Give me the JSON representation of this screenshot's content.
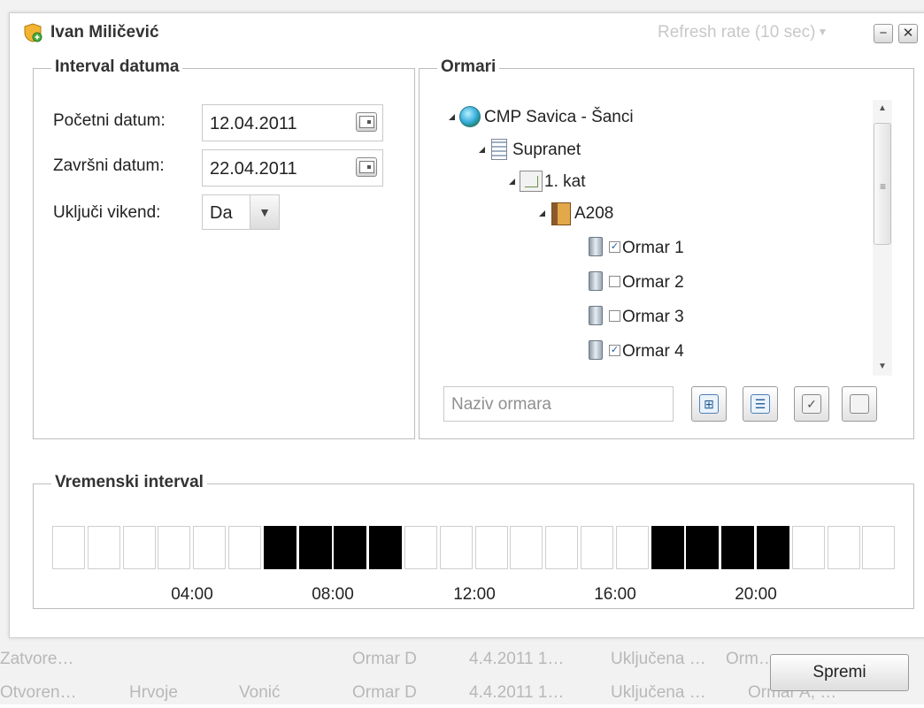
{
  "window": {
    "title": "Ivan Miličević",
    "refresh_rate": "Refresh rate (10 sec)",
    "minimize_glyph": "−",
    "close_glyph": "✕"
  },
  "date_interval": {
    "legend": "Interval datuma",
    "start_label": "Početni datum:",
    "start_value": "12.04.2011",
    "end_label": "Završni datum:",
    "end_value": "22.04.2011",
    "weekend_label": "Uključi vikend:",
    "weekend_value": "Da"
  },
  "cabinets": {
    "legend": "Ormari",
    "tree": {
      "root": "CMP Savica - Šanci",
      "building": "Supranet",
      "floor": "1. kat",
      "room": "A208",
      "items": [
        {
          "label": "Ormar 1",
          "checked": true
        },
        {
          "label": "Ormar 2",
          "checked": false
        },
        {
          "label": "Ormar 3",
          "checked": false
        },
        {
          "label": "Ormar 4",
          "checked": true
        }
      ]
    },
    "search_placeholder": "Naziv ormara",
    "toolbar_icons": [
      "expand-tree-icon",
      "list-icon",
      "check-all-icon",
      "uncheck-all-icon"
    ]
  },
  "time_interval": {
    "legend": "Vremenski interval",
    "slots": [
      0,
      0,
      0,
      0,
      0,
      0,
      1,
      1,
      1,
      1,
      0,
      0,
      0,
      0,
      0,
      0,
      0,
      1,
      1,
      1,
      1,
      0,
      0,
      0
    ],
    "tick_labels": [
      "04:00",
      "08:00",
      "12:00",
      "16:00",
      "20:00"
    ],
    "tick_slot_index": [
      4,
      8,
      12,
      16,
      20
    ]
  },
  "save_label": "Spremi",
  "background": {
    "row1": [
      "Zatvore…",
      "Ormar D",
      "4.4.2011 1…",
      "Uključena …",
      "Orm…"
    ],
    "row2": [
      "Otvoren…",
      "Hrvoje",
      "Vonić",
      "Ormar D",
      "4.4.2011 1…",
      "Uključena …",
      "Ormar A, …"
    ]
  }
}
